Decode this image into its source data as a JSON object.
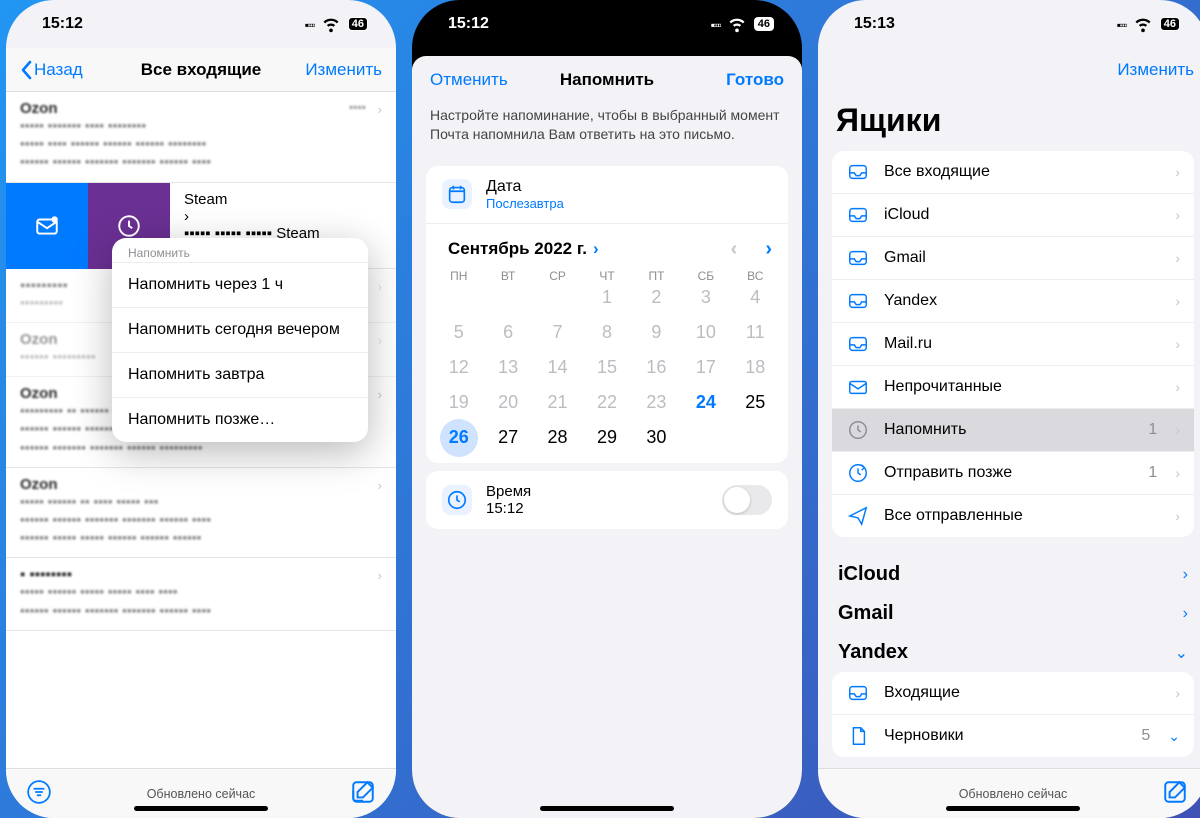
{
  "status": {
    "time1": "15:12",
    "time2": "15:12",
    "time3": "15:13",
    "battery": "46"
  },
  "screen1": {
    "back": "Назад",
    "title": "Все входящие",
    "edit": "Изменить",
    "popup_title": "Напомнить",
    "popup_items": [
      "Напомнить через 1 ч",
      "Напомнить сегодня вечером",
      "Напомнить завтра",
      "Напомнить позже…"
    ],
    "footer": "Обновлено сейчас"
  },
  "screen2": {
    "cancel": "Отменить",
    "title": "Напомнить",
    "done": "Готово",
    "desc": "Настройте напоминание, чтобы в выбранный момент Почта напомнила Вам ответить на это письмо.",
    "date_label": "Дата",
    "date_value": "Послезавтра",
    "month": "Сентябрь 2022 г.",
    "dow": [
      "ПН",
      "ВТ",
      "СР",
      "ЧТ",
      "ПТ",
      "СБ",
      "ВС"
    ],
    "time_label": "Время",
    "time_value": "15:12"
  },
  "screen3": {
    "edit": "Изменить",
    "title": "Ящики",
    "boxes": [
      {
        "label": "Все входящие"
      },
      {
        "label": "iCloud"
      },
      {
        "label": "Gmail"
      },
      {
        "label": "Yandex"
      },
      {
        "label": "Mail.ru"
      },
      {
        "label": "Непрочитанные"
      },
      {
        "label": "Напомнить",
        "count": "1",
        "selected": true
      },
      {
        "label": "Отправить позже",
        "count": "1"
      },
      {
        "label": "Все отправленные"
      }
    ],
    "sections": [
      "iCloud",
      "Gmail",
      "Yandex"
    ],
    "yandex_rows": [
      {
        "label": "Входящие"
      },
      {
        "label": "Черновики",
        "count": "5",
        "expand": true
      }
    ],
    "footer": "Обновлено сейчас"
  }
}
